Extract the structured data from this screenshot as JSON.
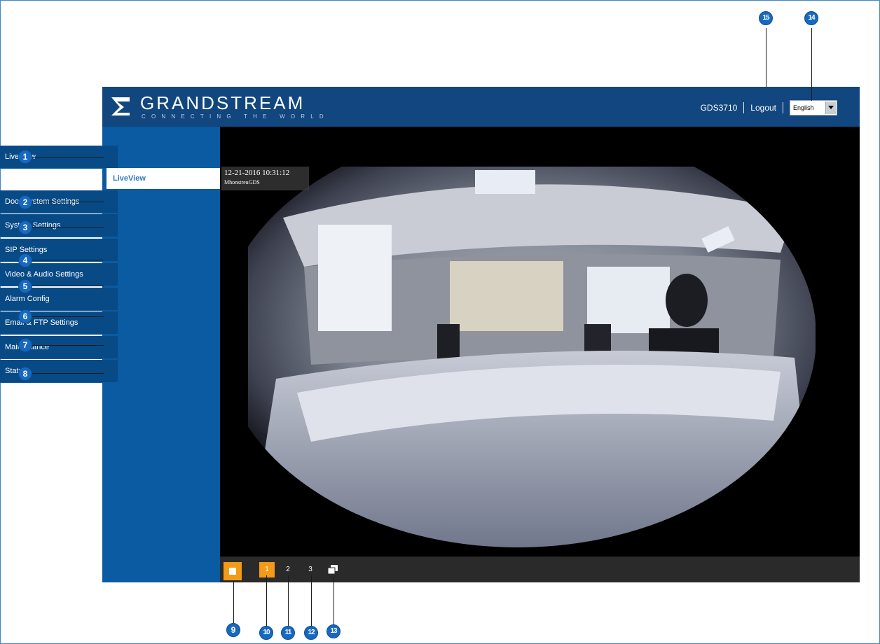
{
  "brand": {
    "name": "GRANDSTREAM",
    "tagline": "CONNECTING THE WORLD"
  },
  "header": {
    "model": "GDS3710",
    "logout_label": "Logout",
    "language_selected": "English"
  },
  "sidebar": {
    "items": [
      {
        "label": "LiveView"
      },
      {
        "label": "Door System Settings"
      },
      {
        "label": "System Settings"
      },
      {
        "label": "SIP Settings"
      },
      {
        "label": "Video & Audio Settings"
      },
      {
        "label": "Alarm Config"
      },
      {
        "label": "Email & FTP Settings"
      },
      {
        "label": "Maintenance"
      },
      {
        "label": "Status"
      }
    ],
    "active_sub": "LiveView"
  },
  "video": {
    "timestamp": "12-21-2016 10:31:12",
    "camera_name": "MhonstreuGDS"
  },
  "controls": {
    "stream_1": "1",
    "stream_2": "2",
    "stream_3": "3"
  },
  "callouts": {
    "c1": "1",
    "c2": "2",
    "c3": "3",
    "c4": "4",
    "c5": "5",
    "c6": "6",
    "c7": "7",
    "c8": "8",
    "c9": "9",
    "c10": "10",
    "c11": "11",
    "c12": "12",
    "c13": "13",
    "c14": "14",
    "c15": "15"
  },
  "colors": {
    "header_bg": "#12467e",
    "sidebar_bg": "#0a5ba1",
    "menu_item_bg": "#084a86",
    "accent_orange": "#f39a17",
    "callout_blue": "#1769c0"
  },
  "icons": {
    "logo": "grandstream-logo-icon",
    "stop": "stop-icon",
    "windows": "window-switch-icon",
    "dropdown": "chevron-down-icon"
  }
}
